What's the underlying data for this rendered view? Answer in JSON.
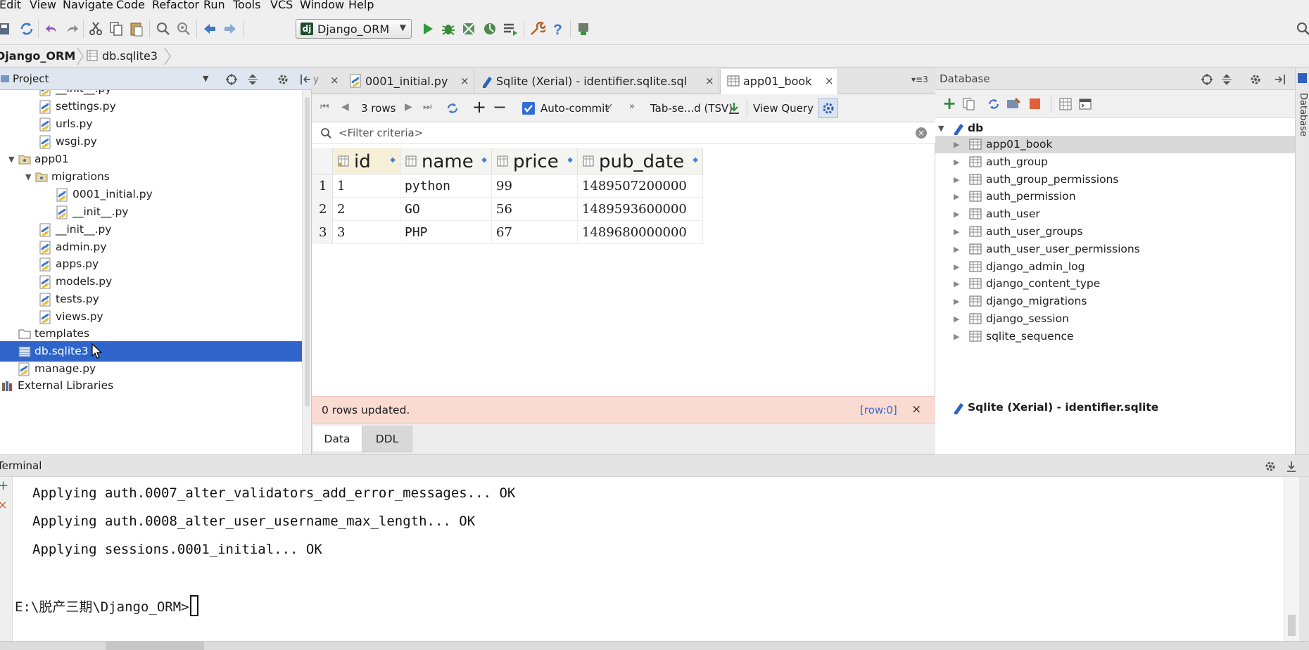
{
  "menu": [
    "Edit",
    "View",
    "Navigate",
    "Code",
    "Refactor",
    "Run",
    "Tools",
    "VCS",
    "Window",
    "Help"
  ],
  "toolbar": {
    "run_config": "Django_ORM"
  },
  "breadcrumb": {
    "project": "Django_ORM",
    "file": "db.sqlite3"
  },
  "project_panel": {
    "title": "Project",
    "items": [
      {
        "label": "__init__.py",
        "kind": "py"
      },
      {
        "label": "settings.py",
        "kind": "py"
      },
      {
        "label": "urls.py",
        "kind": "py"
      },
      {
        "label": "wsgi.py",
        "kind": "py"
      },
      {
        "label": "app01",
        "kind": "pkg"
      },
      {
        "label": "migrations",
        "kind": "pkg"
      },
      {
        "label": "0001_initial.py",
        "kind": "py"
      },
      {
        "label": "__init__.py",
        "kind": "py"
      },
      {
        "label": "__init__.py",
        "kind": "py"
      },
      {
        "label": "admin.py",
        "kind": "py"
      },
      {
        "label": "apps.py",
        "kind": "py"
      },
      {
        "label": "models.py",
        "kind": "py"
      },
      {
        "label": "tests.py",
        "kind": "py"
      },
      {
        "label": "views.py",
        "kind": "py"
      },
      {
        "label": "templates",
        "kind": "folder"
      },
      {
        "label": "db.sqlite3",
        "kind": "db"
      },
      {
        "label": "manage.py",
        "kind": "py"
      },
      {
        "label": "External Libraries",
        "kind": "lib"
      }
    ]
  },
  "editor": {
    "tabs": [
      {
        "label": "0001_initial.py"
      },
      {
        "label": "Sqlite (Xerial) - identifier.sqlite.sql"
      },
      {
        "label": "app01_book"
      }
    ],
    "grid_toolbar": {
      "rows_label": "3 rows",
      "autocommit": "Auto-commit",
      "export_format": "Tab-se...d (TSV)",
      "view_query": "View Query"
    },
    "filter_placeholder": "<Filter criteria>",
    "columns": [
      "id",
      "name",
      "price",
      "pub_date"
    ],
    "rows": [
      {
        "n": "1",
        "cells": [
          "1",
          "python",
          "99",
          "1489507200000"
        ]
      },
      {
        "n": "2",
        "cells": [
          "2",
          "GO",
          "56",
          "1489593600000"
        ]
      },
      {
        "n": "3",
        "cells": [
          "3",
          "PHP",
          "67",
          "1489680000000"
        ]
      }
    ],
    "status": {
      "message": "0 rows updated.",
      "position": "[row:0]"
    },
    "subtabs": [
      "Data",
      "DDL"
    ]
  },
  "database_panel": {
    "title": "Database",
    "root": "db",
    "tables": [
      "app01_book",
      "auth_group",
      "auth_group_permissions",
      "auth_permission",
      "auth_user",
      "auth_user_groups",
      "auth_user_user_permissions",
      "django_admin_log",
      "django_content_type",
      "django_migrations",
      "django_session",
      "sqlite_sequence"
    ],
    "datasource": "Sqlite (Xerial) - identifier.sqlite"
  },
  "right_strip_label": "Database",
  "terminal": {
    "title": "Terminal",
    "lines": [
      "Applying auth.0007_alter_validators_add_error_messages... OK",
      "Applying auth.0008_alter_user_username_max_length... OK",
      "Applying sessions.0001_initial... OK"
    ],
    "prompt": "E:\\脱产三期\\Django_ORM>"
  }
}
